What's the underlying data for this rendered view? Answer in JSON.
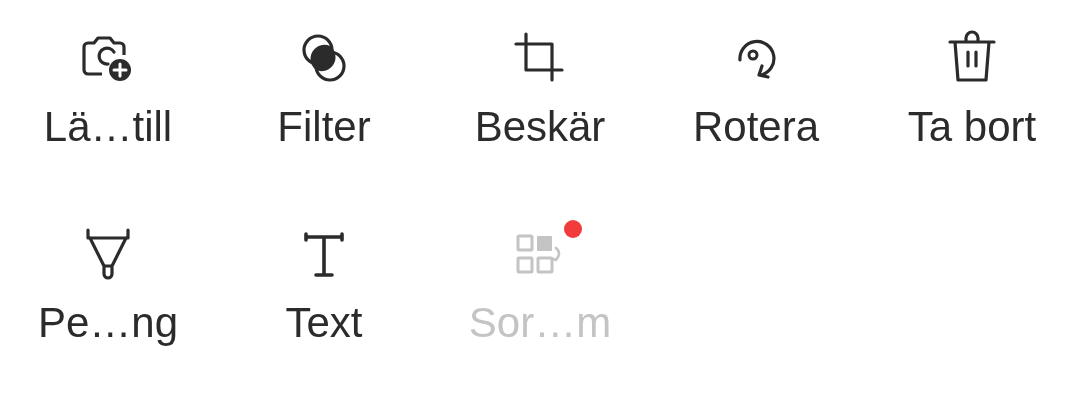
{
  "tools": [
    {
      "kind": "camera-add",
      "label": "Lä…till",
      "disabled": false,
      "badge": false
    },
    {
      "kind": "filter",
      "label": "Filter",
      "disabled": false,
      "badge": false
    },
    {
      "kind": "crop",
      "label": "Beskär",
      "disabled": false,
      "badge": false
    },
    {
      "kind": "rotate",
      "label": "Rotera",
      "disabled": false,
      "badge": false
    },
    {
      "kind": "delete",
      "label": "Ta bort",
      "disabled": false,
      "badge": false
    },
    {
      "kind": "pen",
      "label": "Pe…ng",
      "disabled": false,
      "badge": false
    },
    {
      "kind": "text",
      "label": "Text",
      "disabled": false,
      "badge": false
    },
    {
      "kind": "sort",
      "label": "Sor…m",
      "disabled": true,
      "badge": true
    }
  ]
}
